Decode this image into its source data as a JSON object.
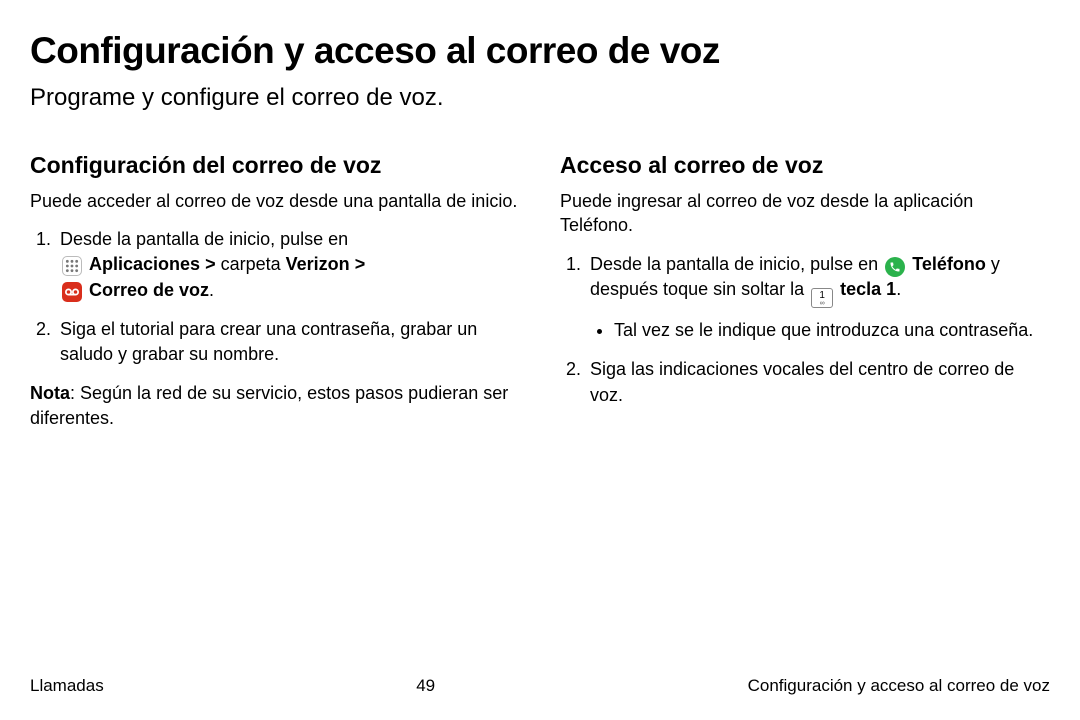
{
  "title": "Configuración y acceso al correo de voz",
  "subtitle": "Programe y configure el correo de voz.",
  "left": {
    "heading": "Configuración del correo de voz",
    "intro": "Puede acceder al correo de voz desde una pantalla de inicio.",
    "step1_pre": "Desde la pantalla de inicio, pulse en ",
    "apps_label": "Aplicaciones",
    "carpeta": " carpeta ",
    "verizon": "Verizon",
    "correo_voz": "Correo de voz",
    "step2": "Siga el tutorial para crear una contraseña, grabar un saludo y grabar su nombre.",
    "note_label": "Nota",
    "note_text": ": Según la red de su servicio, estos pasos pudieran ser diferentes."
  },
  "right": {
    "heading": "Acceso al correo de voz",
    "intro": "Puede ingresar al correo de voz desde la aplicación Teléfono.",
    "step1_a": "Desde la pantalla de inicio, pulse en ",
    "telefono": "Teléfono",
    "step1_b": " y después toque sin soltar la ",
    "tecla1": "tecla 1",
    "bullet1": "Tal vez se le indique que introduzca una contraseña.",
    "step2": "Siga las indicaciones vocales del centro de correo de voz."
  },
  "footer": {
    "left": "Llamadas",
    "page": "49",
    "right": "Configuración y acceso al correo de voz"
  },
  "chevron": ">"
}
